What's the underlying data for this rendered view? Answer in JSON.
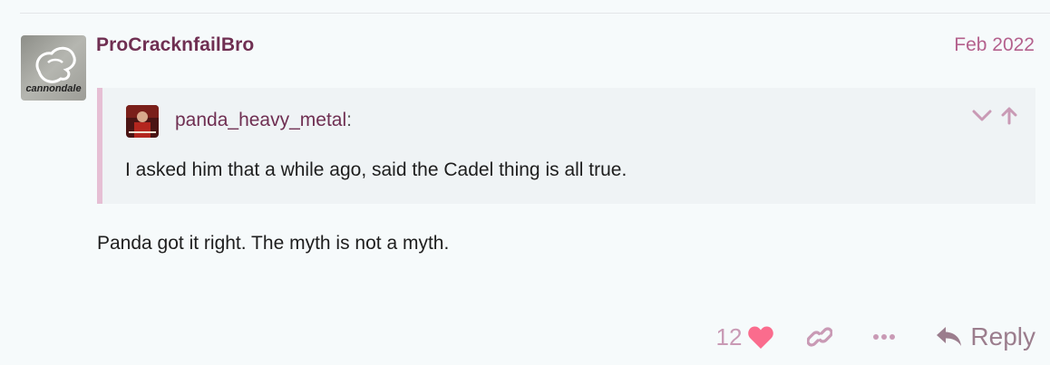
{
  "post": {
    "username": "ProCracknfailBro",
    "date": "Feb 2022",
    "avatar_icon": "cannondale-logo-avatar",
    "avatar_text": "cannondale",
    "body": "Panda got it right. The myth is not a myth."
  },
  "quote": {
    "username": "panda_heavy_metal",
    "colon": ":",
    "avatar_icon": "user-avatar",
    "text": "I asked him that a while ago, said the Cadel thing is all true.",
    "controls": [
      "chevron-down-icon",
      "arrow-up-icon"
    ]
  },
  "actions": {
    "like_count": "12",
    "like_icon": "heart-icon",
    "link_icon": "link-icon",
    "more_icon": "ellipsis-icon",
    "reply_icon": "reply-arrow-icon",
    "reply_label": "Reply"
  },
  "colors": {
    "username": "#6f2f52",
    "date": "#b4618d",
    "heart": "#fa6c8d",
    "quote_border": "#e6bfd4",
    "background": "#f6fafb"
  }
}
